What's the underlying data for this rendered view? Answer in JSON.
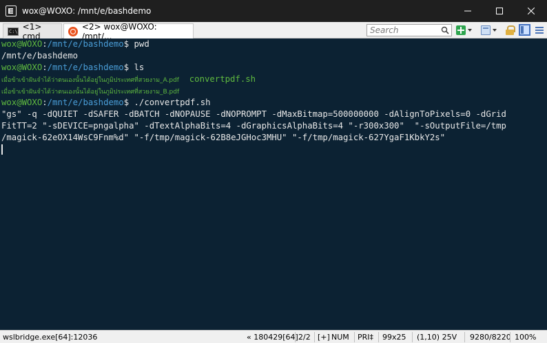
{
  "window": {
    "title": "wox@WOXO: /mnt/e/bashdemo",
    "minimize_icon": "minimize-icon",
    "maximize_icon": "maximize-icon",
    "close_icon": "close-icon"
  },
  "tabs": [
    {
      "label": "<1> cmd",
      "icon": "cmd-icon",
      "active": false
    },
    {
      "label": "<2> wox@WOXO: /mnt/...",
      "icon": "ubuntu-icon",
      "active": true
    }
  ],
  "toolbar": {
    "search_placeholder": "Search",
    "search_value": ""
  },
  "terminal": {
    "colors": {
      "background": "#0c2233",
      "user": "#5fba3f",
      "path": "#4a9ed8",
      "text": "#e8e8e8"
    },
    "prompt_user": "wox@WOXO",
    "prompt_sep": ":",
    "prompt_path": "/mnt/e/bashdemo",
    "prompt_dollar": "$ ",
    "lines": [
      {
        "kind": "prompt",
        "cmd": "pwd"
      },
      {
        "kind": "out",
        "text": "/mnt/e/bashdemo"
      },
      {
        "kind": "prompt",
        "cmd": "ls"
      },
      {
        "kind": "files",
        "file1": "เมื่อข้าเข้าฝันจำได้ว่าตนเองนั้นได้อยู่ในภูมิประเทศที่สวยงาม_A.pdf",
        "file2": "convertpdf.sh"
      },
      {
        "kind": "files1",
        "file1": "เมื่อข้าเข้าฝันจำได้ว่าตนเองนั้นได้อยู่ในภูมิประเทศที่สวยงาม_B.pdf"
      },
      {
        "kind": "prompt",
        "cmd": "./convertpdf.sh"
      },
      {
        "kind": "out",
        "text": "\"gs\" -q -dQUIET -dSAFER -dBATCH -dNOPAUSE -dNOPROMPT -dMaxBitmap=500000000 -dAlignToPixels=0 -dGrid"
      },
      {
        "kind": "out",
        "text": "FitTT=2 \"-sDEVICE=pngalpha\" -dTextAlphaBits=4 -dGraphicsAlphaBits=4 \"-r300x300\"  \"-sOutputFile=/tmp"
      },
      {
        "kind": "out",
        "text": "/magick-62eOX14WsC9Fnm%d\" \"-f/tmp/magick-62B8eJGHoc3MHU\" \"-f/tmp/magick-627YgaF1KbkY2s\""
      }
    ]
  },
  "status": {
    "process": "wslbridge.exe[64]:12036",
    "build": "« 180429[64]",
    "console_index": "2/2",
    "add_indicator": "[+]",
    "num": "NUM",
    "pri": "PRI‡",
    "size": "99x25",
    "cursor": "(1,10) 25V",
    "buffer": "9280/8220",
    "zoom": "100%"
  }
}
